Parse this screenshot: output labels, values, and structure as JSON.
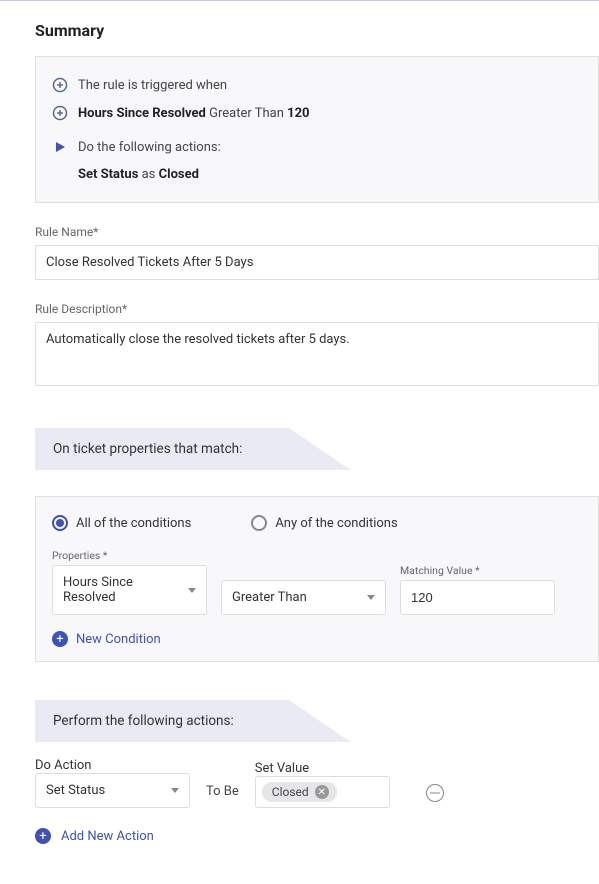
{
  "title": "Summary",
  "summary": {
    "trigger_text": "The rule is triggered when",
    "condition_field": "Hours Since Resolved",
    "condition_op": "Greater Than",
    "condition_value": "120",
    "actions_intro": "Do the following actions:",
    "action_name": "Set Status",
    "action_join": "as",
    "action_value": "Closed"
  },
  "rule_name": {
    "label": "Rule Name*",
    "value": "Close Resolved Tickets After 5 Days"
  },
  "rule_description": {
    "label": "Rule Description*",
    "value": "Automatically close the resolved tickets after 5 days."
  },
  "conditions": {
    "header": "On ticket properties that match:",
    "radio_all": "All of the conditions",
    "radio_any": "Any of the conditions",
    "selected": "all",
    "props_label": "Properties *",
    "props_value": "Hours Since Resolved",
    "op_value": "Greater Than",
    "match_label": "Matching Value *",
    "match_value": "120",
    "new_condition": "New Condition"
  },
  "actions": {
    "header": "Perform the following actions:",
    "do_label": "Do Action",
    "do_value": "Set Status",
    "tobe": "To Be",
    "val_label": "Set Value",
    "val_value": "Closed",
    "add_new": "Add New Action"
  }
}
